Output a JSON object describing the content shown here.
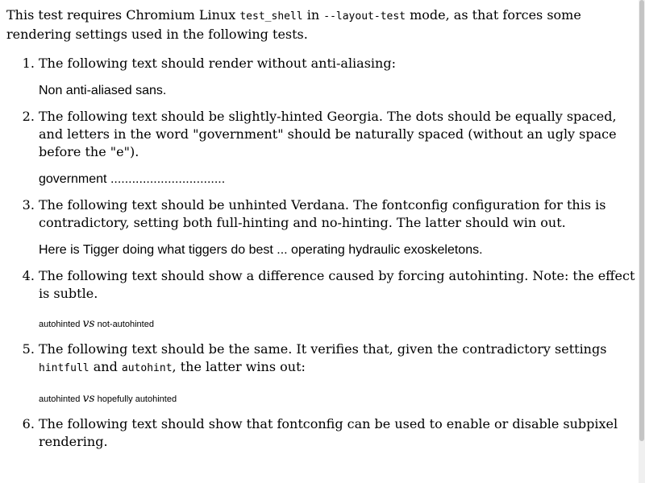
{
  "intro": {
    "text_a": "This test requires Chromium Linux",
    "code_a": "test_shell",
    "text_b": "in",
    "code_b": "--layout-test",
    "text_c": "mode, as that forces some rendering settings used in the following tests."
  },
  "tests": [
    {
      "number": "1.",
      "description": "The following text should render without anti-aliasing:",
      "sample": "Non anti-aliased sans."
    },
    {
      "number": "2.",
      "description": "The following text should be slightly-hinted Georgia. The dots should be equally spaced, and letters in the word \"government\" should be naturally spaced (without an ugly space before the \"e\").",
      "sample": "government ................................"
    },
    {
      "number": "3.",
      "description": "The following text should be unhinted Verdana. The fontconfig configuration for this is contradictory, setting both full-hinting and no-hinting. The latter should win out.",
      "sample": "Here is Tigger doing what tiggers do best ... operating hydraulic exoskeletons."
    },
    {
      "number": "4.",
      "description": "The following text should show a difference caused by forcing autohinting. Note: the effect is subtle.",
      "sample_left": "autohinted",
      "vs": "vs",
      "sample_right": "not-autohinted"
    },
    {
      "number": "5.",
      "description_a": "The following text should be the same. It verifies that, given the contradictory settings",
      "code_a": "hintfull",
      "description_b": "and",
      "code_b": "autohint",
      "description_c": ", the latter wins out:",
      "sample_left": "autohinted",
      "vs": "vs",
      "sample_right": "hopefully autohinted"
    },
    {
      "number": "6.",
      "description": "The following text should show that fontconfig can be used to enable or disable subpixel rendering."
    }
  ]
}
